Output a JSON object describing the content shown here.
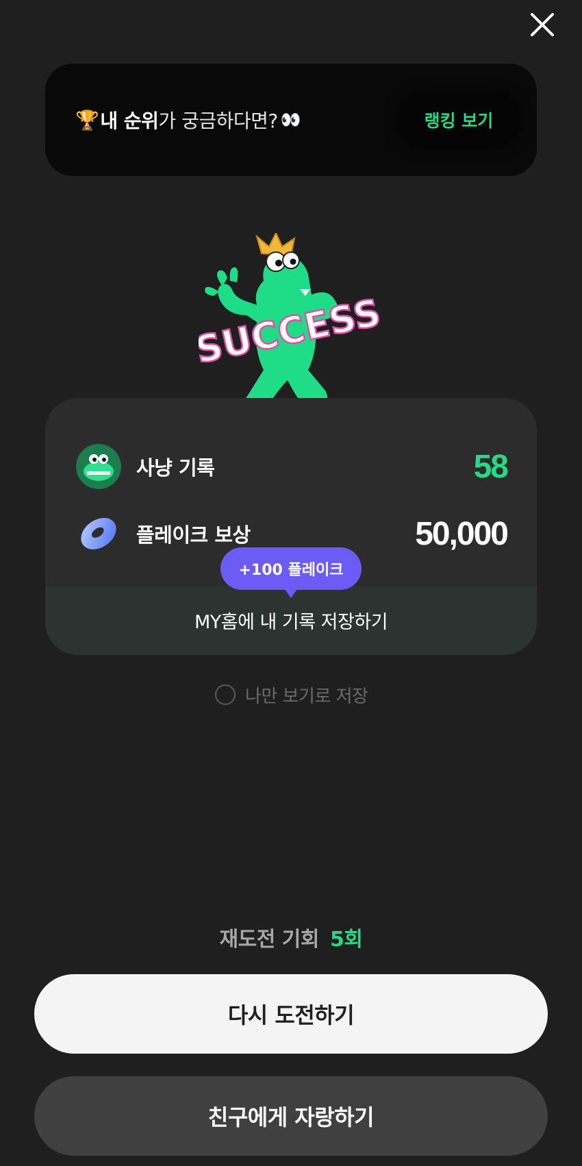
{
  "close": {
    "icon": "close-icon"
  },
  "ranking_banner": {
    "trophy_icon": "trophy-icon",
    "text_strong": "내 순위",
    "text_rest": "가 궁금하다면?",
    "eyes_icon": "eyes-icon",
    "button_label": "랭킹 보기"
  },
  "mascot": {
    "icon": "success-mascot-icon",
    "success_text": "SUCCESS"
  },
  "result": {
    "hunt": {
      "icon": "croc-avatar-icon",
      "label": "사냥 기록",
      "value": "58"
    },
    "flake": {
      "icon": "flake-donut-icon",
      "label": "플레이크 보상",
      "value": "50,000"
    },
    "bonus_badge": "+100 플레이크",
    "save_label": "MY홈에 내 기록 저장하기"
  },
  "private_save": {
    "label": "나만 보기로 저장",
    "checked": false
  },
  "retry": {
    "label": "재도전 기회",
    "count": "5회"
  },
  "buttons": {
    "retry_label": "다시 도전하기",
    "share_label": "친구에게 자랑하기"
  },
  "colors": {
    "background": "#1f1f1f",
    "accent_green": "#27d884",
    "bonus_purple": "#6b5cf6",
    "card": "#2c2c2d"
  }
}
